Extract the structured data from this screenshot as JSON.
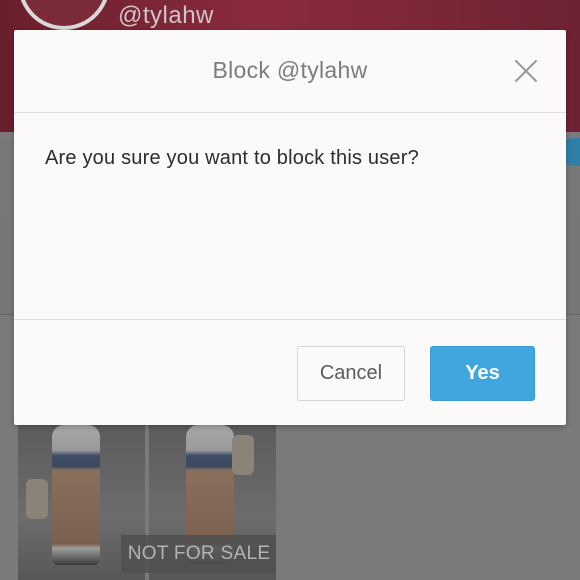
{
  "background": {
    "username": "@tylahw",
    "photo_badge": "NOT FOR SALE"
  },
  "modal": {
    "title": "Block @tylahw",
    "message": "Are you sure you want to block this user?",
    "close_icon": "close-icon",
    "cancel_label": "Cancel",
    "confirm_label": "Yes"
  },
  "colors": {
    "accent": "#3fa7de",
    "overlay": "#6f6f6f"
  }
}
